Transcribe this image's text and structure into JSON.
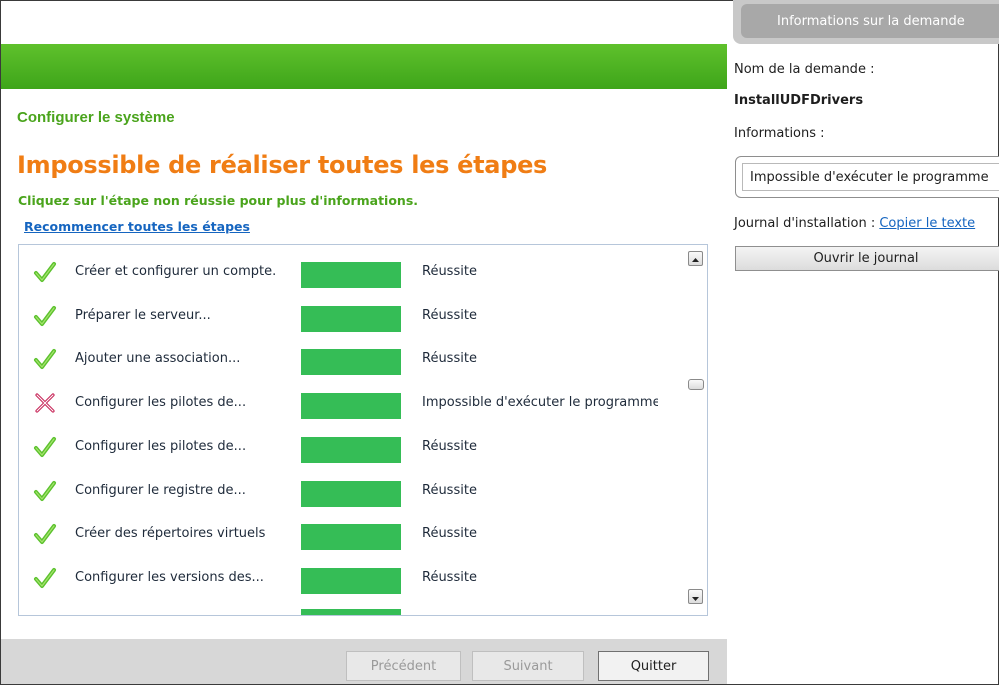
{
  "left": {
    "section_title": "Configurer le système",
    "error_heading": "Impossible de réaliser toutes les étapes",
    "instruction": "Cliquez sur l'étape non réussie pour plus d'informations.",
    "restart_link": "Recommencer toutes les étapes",
    "steps": [
      {
        "name": "Créer et configurer un compte.",
        "status": "Réussite",
        "state": "success"
      },
      {
        "name": "Préparer le serveur...",
        "status": "Réussite",
        "state": "success"
      },
      {
        "name": "Ajouter une association...",
        "status": "Réussite",
        "state": "success"
      },
      {
        "name": "Configurer les pilotes de...",
        "status": "Impossible d'exécuter le programme",
        "state": "failure"
      },
      {
        "name": "Configurer les pilotes de...",
        "status": "Réussite",
        "state": "success"
      },
      {
        "name": "Configurer le registre de...",
        "status": "Réussite",
        "state": "success"
      },
      {
        "name": "Créer des répertoires virtuels",
        "status": "Réussite",
        "state": "success"
      },
      {
        "name": "Configurer les versions des...",
        "status": "Réussite",
        "state": "success"
      }
    ],
    "buttons": {
      "previous": "Précédent",
      "next": "Suivant",
      "quit": "Quitter"
    }
  },
  "right": {
    "tab_title": "Informations sur la demande",
    "request_name_label": "Nom de la demande :",
    "request_name": "InstallUDFDrivers",
    "info_label": "Informations :",
    "info_value": "Impossible d'exécuter le programme",
    "log_label": "Journal d'installation :",
    "copy_link": "Copier le texte",
    "open_log_button": "Ouvrir le journal"
  },
  "colors": {
    "banner_green": "#4cb022",
    "heading_orange": "#f07d14",
    "progress_green": "#35bd56",
    "check_green": "#5cc22e",
    "fail_red": "#c8285a",
    "link_blue": "#1565c0"
  }
}
